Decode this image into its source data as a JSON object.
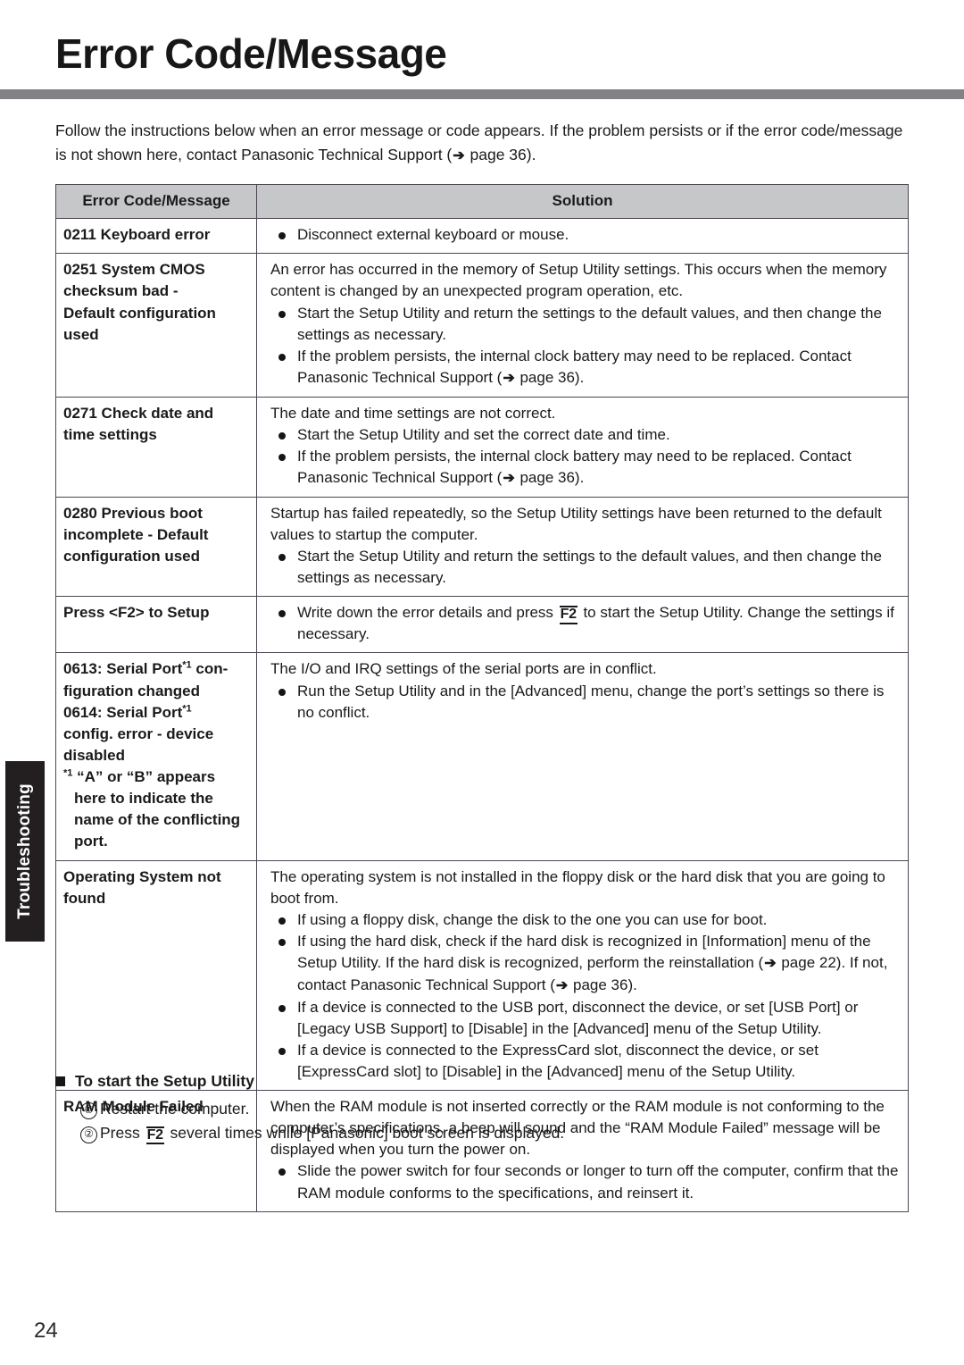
{
  "header": {
    "title": "Error Code/Message"
  },
  "intro": {
    "text_before_arrow": "Follow the instructions below when an error message or code appears. If the problem persists or if the error code/message is not shown here, contact Panasonic Technical Support (",
    "arrow": "➔",
    "text_after_arrow": " page 36)."
  },
  "side_tab": {
    "label": "Troubleshooting"
  },
  "table": {
    "headers": {
      "code": "Error Code/Message",
      "solution": "Solution"
    },
    "rows": [
      {
        "code_lines": [
          "0211 Keyboard error"
        ],
        "intro_lines": [],
        "bullets": [
          "Disconnect external keyboard or mouse."
        ]
      },
      {
        "code_lines": [
          "0251 System CMOS",
          "checksum bad -",
          "Default configuration",
          "used"
        ],
        "intro_lines": [
          "An error has occurred in the memory of Setup Utility settings. This occurs when the memory content is changed by an unexpected program operation, etc."
        ],
        "bullets": [
          "Start the Setup Utility and return the settings to the default values, and then change the settings as necessary.",
          "If the problem persists, the internal clock battery may need to be replaced. Contact Panasonic Technical Support (➔ page 36)."
        ]
      },
      {
        "code_lines": [
          "0271 Check date and",
          "time settings"
        ],
        "intro_lines": [
          "The date and time settings are not correct."
        ],
        "bullets": [
          "Start the Setup Utility and set the correct date and time.",
          "If the problem persists, the internal clock battery may need to be replaced. Contact Panasonic Technical Support (➔ page 36)."
        ]
      },
      {
        "code_lines": [
          "0280 Previous boot",
          "incomplete - Default",
          "configuration used"
        ],
        "intro_lines": [
          "Startup has failed repeatedly, so the Setup Utility settings have been returned to the default values to startup the computer."
        ],
        "bullets": [
          "Start the Setup Utility and return the settings to the default values, and then change the settings as necessary."
        ]
      },
      {
        "code_lines": [
          "Press <F2> to Setup"
        ],
        "intro_lines": [],
        "bullets_html": [
          "Write down the error details and press <span class=\"fkey\">F2</span> to start the Setup Utility. Change the settings if necessary."
        ]
      },
      {
        "code_lines": [],
        "code_html": "0613: Serial Port<span class=\"sup\">*1</span> con-<br>figuration changed<br>0614: Serial Port<span class=\"sup\">*1</span><br>config. error - device<br>disabled<br><span class=\"note\"><span class=\"sup\">*1</span> “A” or “B” appears here to indicate the name of the conflicting port.</span>",
        "intro_lines": [
          "The I/O and IRQ settings of the serial ports are in conflict."
        ],
        "bullets": [
          "Run the Setup Utility and in the [Advanced] menu, change the port’s settings so there is no conflict."
        ]
      },
      {
        "code_lines": [
          "Operating System not",
          "found"
        ],
        "intro_lines": [
          "The operating system is not installed in the floppy disk or the hard disk that you are going to boot from."
        ],
        "bullets": [
          "If using a floppy disk, change the disk to the one you can use for boot.",
          "If using the hard disk, check if the hard disk is recognized in [Information] menu of the Setup Utility. If the hard disk is recognized, perform the reinstallation (➔ page 22). If not, contact Panasonic Technical Support (➔ page 36).",
          "If a device is connected to the USB port, disconnect the device, or set [USB Port] or [Legacy USB Support] to [Disable] in the [Advanced] menu of the Setup Utility.",
          "If a device is connected to the ExpressCard slot, disconnect the device, or set [ExpressCard slot] to [Disable] in the [Advanced] menu of the Setup Utility."
        ]
      },
      {
        "code_lines": [
          "RAM Module Failed"
        ],
        "intro_lines": [
          "When the RAM module is not inserted correctly or the RAM module is not conforming to the computer’s specifications, a beep will sound and the “RAM Module Failed” message will be displayed when you turn the power on."
        ],
        "bullets": [
          "Slide the power switch for four seconds or longer to turn off the computer, confirm that the RAM module conforms to the specifications, and reinsert it."
        ]
      }
    ]
  },
  "note_section": {
    "heading": "To start the Setup Utility",
    "steps": [
      {
        "marker": "①",
        "text": "Restart the computer."
      },
      {
        "marker": "②",
        "text_before_key": "Press ",
        "key": "F2",
        "text_after_key": " several times while [Panasonic] boot screen is displayed."
      }
    ]
  },
  "footer": {
    "page_number": "24"
  }
}
